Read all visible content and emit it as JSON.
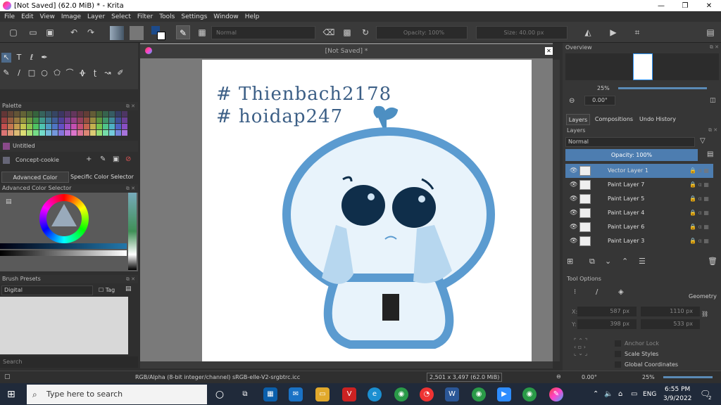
{
  "window": {
    "title": "[Not Saved]  (62.0 MiB)  * - Krita",
    "min": "—",
    "max": "❐",
    "close": "✕"
  },
  "menu": [
    "File",
    "Edit",
    "View",
    "Image",
    "Layer",
    "Select",
    "Filter",
    "Tools",
    "Settings",
    "Window",
    "Help"
  ],
  "toolbar": {
    "blend_mode": "Normal",
    "opacity": "Opacity: 100%",
    "size": "Size: 40.00 px"
  },
  "palette": {
    "title": "Palette",
    "name": "Untitled",
    "set": "Concept-cookie"
  },
  "color_selector": {
    "tab1": "Advanced Color Selector",
    "tab2": "Specific Color Selector",
    "title": "Advanced Color Selector"
  },
  "brush_presets": {
    "title": "Brush Presets",
    "filter": "Digital",
    "tag": "Tag",
    "search_placeholder": "Search"
  },
  "canvas": {
    "tab_title": "[Not Saved]  *",
    "text_line1": "# Thienbach2178",
    "text_line2": "# hoidap247"
  },
  "overview": {
    "title": "Overview",
    "zoom": "25%",
    "rotation": "0.00°"
  },
  "docker_tabs": [
    "Layers",
    "Compositions",
    "Undo History"
  ],
  "layers": {
    "title": "Layers",
    "blend": "Normal",
    "opacity": "Opacity:  100%",
    "items": [
      {
        "name": "Vector Layer 1",
        "selected": true
      },
      {
        "name": "Paint Layer 7",
        "selected": false
      },
      {
        "name": "Paint Layer 5",
        "selected": false
      },
      {
        "name": "Paint Layer 4",
        "selected": false
      },
      {
        "name": "Paint Layer 6",
        "selected": false
      },
      {
        "name": "Paint Layer 3",
        "selected": false
      }
    ]
  },
  "tool_options": {
    "title": "Tool Options",
    "geometry": "Geometry",
    "x_label": "X:",
    "x_val": "587 px",
    "w_val": "1110 px",
    "y_label": "Y:",
    "y_val": "398 px",
    "h_val": "533 px",
    "anchor": "Anchor Lock",
    "scale": "Scale Styles",
    "global": "Global Coordinates"
  },
  "status": {
    "color_space": "RGB/Alpha (8-bit integer/channel)  sRGB-elle-V2-srgbtrc.icc",
    "size": "2,501 x 3,497 (62.0 MiB)",
    "rotation": "0.00°",
    "zoom": "25%"
  },
  "taskbar": {
    "search": "Type here to search",
    "lang": "ENG",
    "time": "6:55 PM",
    "date": "3/9/2022",
    "notif": "2"
  },
  "colors": {
    "accent": "#4d7db0",
    "character": "#5b9bd0",
    "eyes": "#0f2e4a"
  }
}
